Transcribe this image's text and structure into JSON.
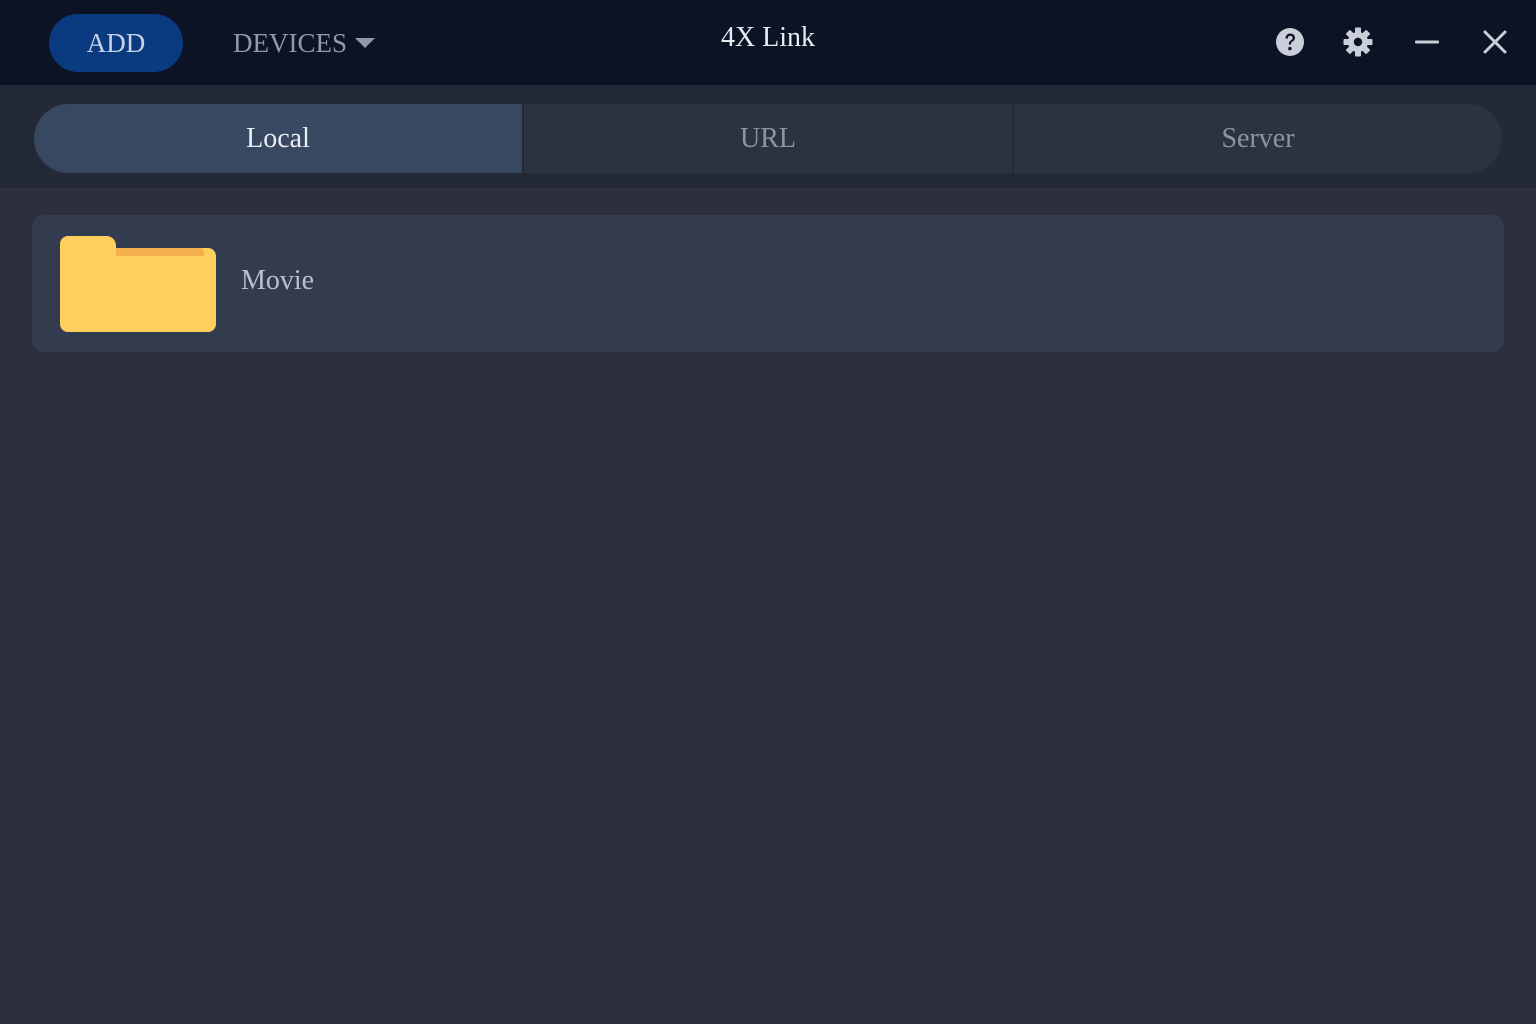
{
  "titlebar": {
    "add_label": "ADD",
    "devices_label": "DEVICES",
    "app_title": "4X Link",
    "icons": [
      "help-icon",
      "gear-icon",
      "minimize-icon",
      "close-icon"
    ]
  },
  "tabs": [
    {
      "label": "Local",
      "active": true
    },
    {
      "label": "URL",
      "active": false
    },
    {
      "label": "Server",
      "active": false
    }
  ],
  "items": [
    {
      "label": "Movie",
      "icon": "folder-icon"
    }
  ],
  "colors": {
    "titlebar_bg": "#0b1324",
    "add_button": "#0a3a80",
    "active_tab": "#394861",
    "folder": "#ffcf5e",
    "folder_tab": "#f5b04e",
    "content_bg": "#2b303c"
  }
}
